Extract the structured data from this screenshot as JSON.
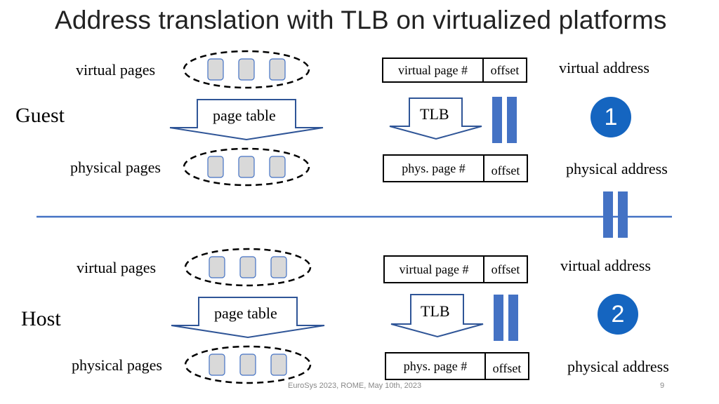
{
  "title": "Address translation with TLB on virtualized platforms",
  "colors": {
    "accent": "#4472c4",
    "badge": "#1565c0",
    "page_fill": "#d9d9d9"
  },
  "sections": [
    {
      "name": "Guest",
      "virtual_pages_label": "virtual pages",
      "physical_pages_label": "physical pages",
      "page_table_label": "page table",
      "tlb_label": "TLB",
      "virtual_address": {
        "page_field": "virtual page #",
        "offset_field": "offset",
        "label": "virtual address"
      },
      "physical_address": {
        "page_field": "phys. page #",
        "offset_field": "offset",
        "label": "physical address"
      },
      "badge": "1"
    },
    {
      "name": "Host",
      "virtual_pages_label": "virtual pages",
      "physical_pages_label": "physical pages",
      "page_table_label": "page table",
      "tlb_label": "TLB",
      "virtual_address": {
        "page_field": "virtual page #",
        "offset_field": "offset",
        "label": "virtual address"
      },
      "physical_address": {
        "page_field": "phys. page #",
        "offset_field": "offset",
        "label": "physical address"
      },
      "badge": "2"
    }
  ],
  "footer": {
    "text": "EuroSys 2023, ROME, May 10th, 2023",
    "page_number": "9"
  }
}
